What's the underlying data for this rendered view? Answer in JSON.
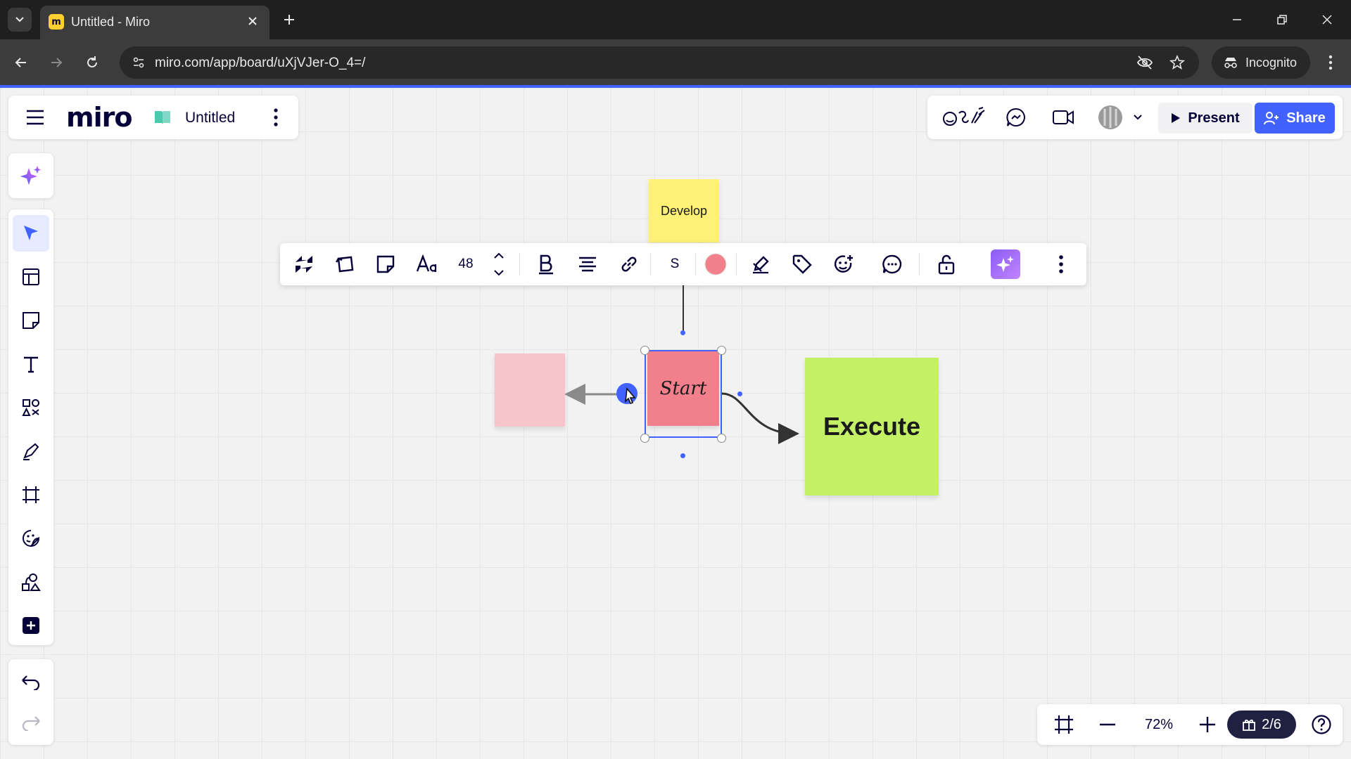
{
  "browser": {
    "tab_title": "Untitled - Miro",
    "favicon_letter": "m",
    "url": "miro.com/app/board/uXjVJer-O_4=/",
    "incognito_label": "Incognito"
  },
  "board": {
    "logo": "miro",
    "name": "Untitled"
  },
  "collab": {
    "present_label": "Present",
    "share_label": "Share"
  },
  "left_tools": [
    "magic-ai",
    "select",
    "templates",
    "sticky-note",
    "text",
    "shapes",
    "pen",
    "frame",
    "stickers",
    "diagramming",
    "add-more"
  ],
  "context_toolbar": {
    "font_size": "48",
    "stroke_style_label": "S",
    "color": "#f1808c"
  },
  "stickies": {
    "develop": "Develop",
    "start": "Start",
    "execute": "Execute",
    "blank": ""
  },
  "zoom": {
    "level": "72%",
    "gift_progress": "2/6"
  },
  "colors": {
    "accent": "#4262ff",
    "develop_yellow": "#fff176",
    "start_pink": "#f1808c",
    "blank_pink": "#f8c4cb",
    "execute_green": "#c3f065"
  }
}
